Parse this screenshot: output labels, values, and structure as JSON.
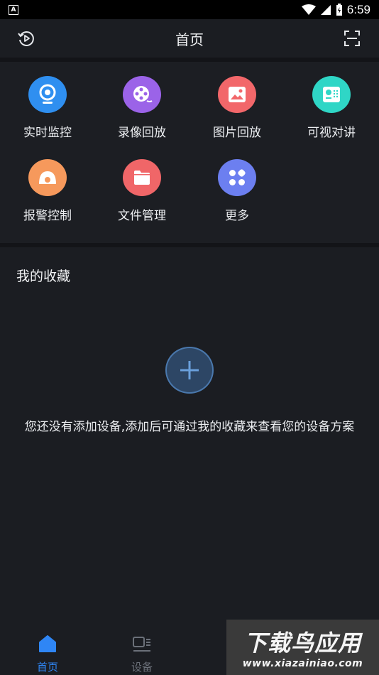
{
  "status_bar": {
    "time": "6:59",
    "notification_icon": "A"
  },
  "header": {
    "title": "首页",
    "left_icon": "playback-history-icon",
    "right_icon": "scan-icon"
  },
  "functions": [
    {
      "label": "实时监控",
      "icon": "camera-icon",
      "color": "#2f8ff0"
    },
    {
      "label": "录像回放",
      "icon": "film-reel-icon",
      "color": "#9b63e8"
    },
    {
      "label": "图片回放",
      "icon": "image-icon",
      "color": "#f2676a"
    },
    {
      "label": "可视对讲",
      "icon": "intercom-icon",
      "color": "#2fd6c6"
    },
    {
      "label": "报警控制",
      "icon": "alarm-icon",
      "color": "#f6995c"
    },
    {
      "label": "文件管理",
      "icon": "folder-icon",
      "color": "#f06668"
    },
    {
      "label": "更多",
      "icon": "grid-more-icon",
      "color": "#6c7ff0"
    }
  ],
  "favorites": {
    "title": "我的收藏",
    "empty_message": "您还没有添加设备,添加后可通过我的收藏来查看您的设备方案"
  },
  "bottom_nav": [
    {
      "label": "首页",
      "icon": "home-icon",
      "active": true
    },
    {
      "label": "设备",
      "icon": "device-icon",
      "active": false
    }
  ],
  "colors": {
    "background": "#1b1d22",
    "active_tab": "#2f86f5",
    "inactive_tab": "#6b7079"
  },
  "watermark": {
    "main": "下载鸟应用",
    "sub": "www.xiazainiao.com"
  }
}
